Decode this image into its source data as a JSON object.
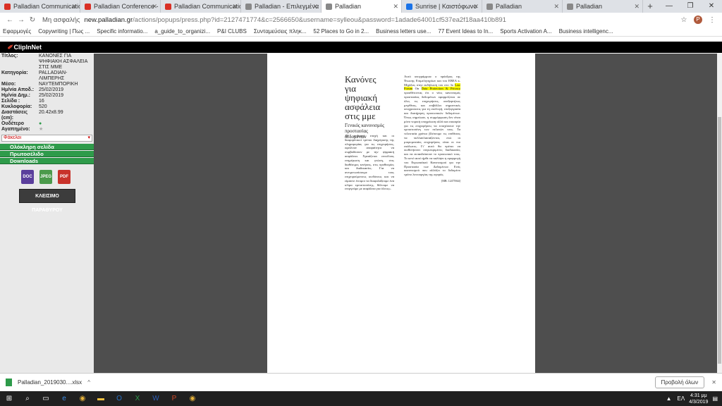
{
  "browser": {
    "tabs": [
      {
        "title": "Palladian Communications",
        "color": "#d93025"
      },
      {
        "title": "Palladian Conference - INV",
        "color": "#d93025"
      },
      {
        "title": "Palladian Communications",
        "color": "#d93025"
      },
      {
        "title": "Palladian - Επιλεγμένα",
        "color": "#888888"
      },
      {
        "title": "Palladian",
        "color": "#888888"
      },
      {
        "title": "Sunrise | Καιστόφωνο",
        "color": "#1a73e8"
      },
      {
        "title": "Palladian",
        "color": "#888888"
      },
      {
        "title": "Palladian",
        "color": "#888888"
      }
    ],
    "new_tab": "+",
    "security": "Μη ασφαλής",
    "url_domain": "new.palladian.gr",
    "url_rest": "/actions/popups/press.php?id=2127471774&c=2566650&username=sylleou&password=1adade64001cf537ea2f18aa410b891",
    "profile_initial": "Ρ",
    "bookmarks": [
      "Εφαρμογές",
      "Copywriting | Πως ...",
      "Specific informatio...",
      "a_guide_to_organizi...",
      "P&I CLUBS",
      "Συνταμεύσεις πληκ...",
      "52 Places to Go in 2...",
      "Business letters use...",
      "77 Event Ideas to In...",
      "Sports Activation A...",
      "Business intelligenc..."
    ]
  },
  "clipinnet": {
    "brand": "ClipInNet",
    "meta": [
      {
        "k": "Τίτλος:",
        "v": "ΚΑΝΟΝΕΣ ΓΙΑ ΨΗΦΙΑΚΗ ΑΣΦΑΛΕΙΑ ΣΤΙΣ ΜΜΕ"
      },
      {
        "k": "Κατηγορία:",
        "v": "PALLADIAN-ΛΙΜΠΕΡΗΣ"
      },
      {
        "k": "Μέσο:",
        "v": "ΝΑΥΤΕΜΠΟΡΙΚΗ"
      },
      {
        "k": "Ημ/νία Αποδ.:",
        "v": "25/02/2019"
      },
      {
        "k": "Ημ/νία Δημ.:",
        "v": "25/02/2019"
      },
      {
        "k": "Σελίδα :",
        "v": "16"
      },
      {
        "k": "Κυκλοφορία:",
        "v": "520"
      },
      {
        "k": "Διαστάσεις (cm):",
        "v": "20.42x8.99"
      },
      {
        "k": "Ουδέτερο",
        "v": ""
      },
      {
        "k": "Αγαπημένο:",
        "v": ""
      }
    ],
    "folder_select": "Φάκελοι",
    "buttons": [
      "Ολόκληρη σελίδα",
      "Πρωτοσέλιδο",
      "Downloads"
    ],
    "downloads": [
      {
        "label": "DOC",
        "color": "#5a3e9c"
      },
      {
        "label": "JPEG",
        "color": "#4b9a4b"
      },
      {
        "label": "PDF",
        "color": "#c8322a"
      }
    ],
    "close_label": "ΚΛΕΙΣΙΜΟ ΠΑΡΑΘΥΡΟΥ"
  },
  "article": {
    "headline": "Κανόνες για ψηφιακή ασφάλεια στις μμε",
    "subhead": "Γενικός κανονισμός προστασίας δεδομένων",
    "col_a": "«Η ψηφιακή εποχή και οι διαφορετικοί τρόποι διαχείρισης της πληροφορίας για τις επιχειρήσεις, οφείλουν απαραίτητα να συμβαδίσουν με την ψηφιακή ασφάλεια. Χρειάζεται επιτέλους ενημέρωση και γνώση, στις διαθέσιμες κινήσεις, στις προθεσμίες και διαδικασίες. Για να αντιμετωπίσουμε τους επιχειρούμενους κινδύνους και να είμαστε έτοιμοι να διαφυλάξουμε ένα κλίμα εμπιστοσύνης, θέλουμε να ενεργούμε με ασφάλεια για όλους».",
    "col_b_1": "Αυτό υπογράμμισε ο πρόεδρος της Ένωσης Επιμελητηρίων και του ΕΒΕΑ κ. Μιχάλος στην εκδήλωση του στο 3ο",
    "hl_1": "Law Forum",
    "col_b_2": "On",
    "hl_2": "Data Protection & Privacy",
    "col_b_3": "προσθέτοντας ότι ο νέος κανονισμός προστασίας δεδομένων εφαρμόζεται σε όλες τις επιχειρήσεις, ανεξαρτήτως μεγέθους, και επιβάλλει σημαντικές υποχρεώσεις για τη συλλογή, επεξεργασία και διατήρηση προσωπικών δεδομένων. Όπως σημείωσε, η συμμόρφωση δεν είναι μόνο νομική υποχρέωση αλλά και ευκαιρία για τις επιχειρήσεις να ενισχύσουν την εμπιστοσύνη των πελατών τους. Τα τελευταία χρόνια βλέπουμε τις επιθέσεις να πολλαπλασιάζονται, ενώ οι μικρομεσαίες επιχειρήσεις είναι οι πιο ευάλωτες. Γι' αυτό θα πρέπει να υιοθετήσουν συγκεκριμένες διαδικασίες και να εκπαιδεύσουν το προσωπικό τους. Το κενό αυτό ήρθε να καλύψει η εφαρμογή του Ευρωπαϊκού Κανονισμού για την Προστασία των Δεδομένων. Ενός κανονισμού που αλλάζει το δεδομένο τρόπο λειτουργίας της αγοράς.",
    "ref": "[ΜΒ: 12475944]"
  },
  "download_bar": {
    "file": "Palladian_2019030....xlsx",
    "show_all": "Προβολή όλων"
  },
  "taskbar": {
    "time": "4:31 μμ",
    "date": "4/3/2019",
    "lang": "ΕΛ"
  }
}
